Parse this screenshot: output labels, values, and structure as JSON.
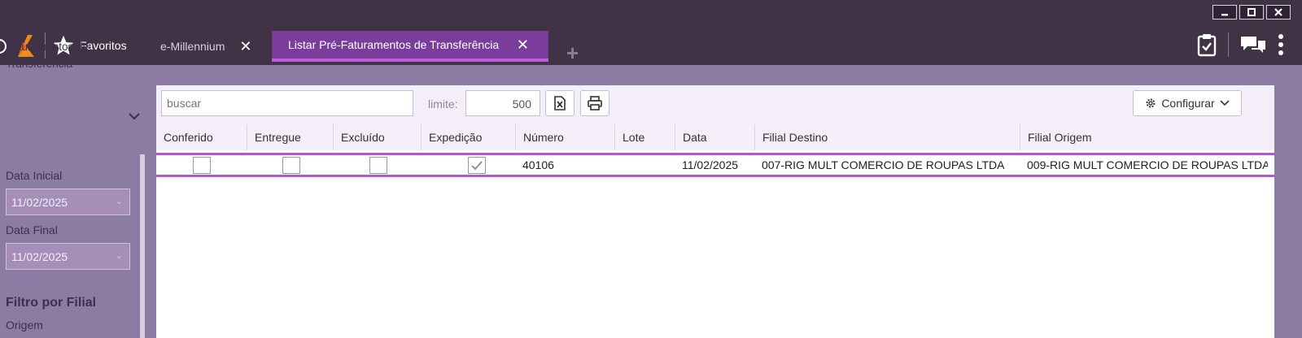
{
  "window": {
    "minimize_label": "minimize",
    "maximize_label": "maximize",
    "close_label": "close"
  },
  "header": {
    "favorites_label": "Favoritos",
    "tabs": [
      {
        "label": "e-Millennium",
        "active": false
      },
      {
        "label": "Listar Pré-Faturamentos de Transferência",
        "active": true
      }
    ],
    "close_glyph": "✕",
    "add_glyph": "+"
  },
  "sidebar": {
    "title": "Listar Pré-Faturamentos de Transferência",
    "data_inicial_label": "Data Inicial",
    "data_inicial_value": "11/02/2025",
    "data_final_label": "Data Final",
    "data_final_value": "11/02/2025",
    "filtro_label": "Filtro por Filial",
    "origem_label": "Origem"
  },
  "toolbar": {
    "search_placeholder": "buscar",
    "limite_label": "limite:",
    "limite_value": "500",
    "config_label": "Configurar"
  },
  "table": {
    "columns": [
      "Conferido",
      "Entregue",
      "Excluído",
      "Expedição",
      "Número",
      "Lote",
      "Data",
      "Filial Destino",
      "Filial Origem"
    ],
    "rows": [
      {
        "conferido": false,
        "entregue": false,
        "excluido": false,
        "expedicao": true,
        "numero": "40106",
        "lote": "",
        "data": "11/02/2025",
        "filial_destino": "007-RIG MULT COMERCIO DE ROUPAS LTDA",
        "filial_origem": "009-RIG MULT COMERCIO DE ROUPAS LTDA"
      }
    ]
  },
  "colors": {
    "topbar": "#413346",
    "accent": "#7a3d9c",
    "highlight": "#b554d6",
    "background": "#8c7ba3"
  }
}
